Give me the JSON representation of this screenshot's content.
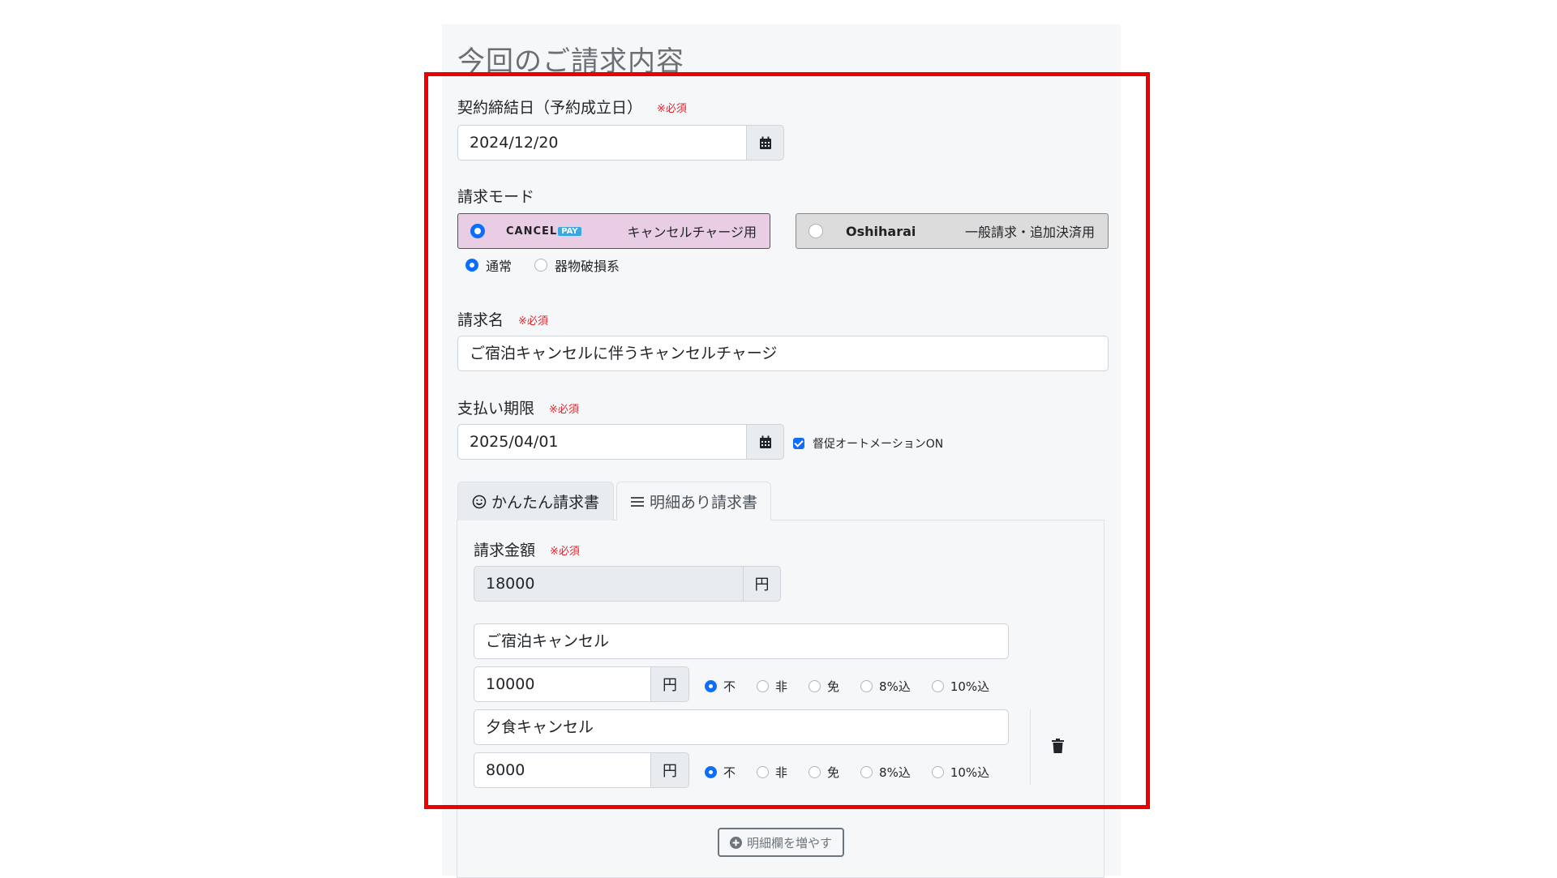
{
  "page": {
    "title": "今回のご請求内容"
  },
  "required_mark": "※必須",
  "contract_date": {
    "label": "契約締結日（予約成立日）",
    "value": "2024/12/20"
  },
  "billing_mode": {
    "label": "請求モード",
    "options": [
      {
        "logo_text": "CANCEL",
        "logo_badge": "PAY",
        "desc": "キャンセルチャージ用",
        "selected": true
      },
      {
        "logo_text": "Oshiharai",
        "desc": "一般請求・追加決済用",
        "selected": false
      }
    ],
    "sub_options": [
      {
        "label": "通常",
        "selected": true
      },
      {
        "label": "器物破損系",
        "selected": false
      }
    ]
  },
  "billing_name": {
    "label": "請求名",
    "value": "ご宿泊キャンセルに伴うキャンセルチャージ"
  },
  "due_date": {
    "label": "支払い期限",
    "value": "2025/04/01",
    "reminder_label": "督促オートメーションON"
  },
  "tabs": [
    {
      "label": "かんたん請求書",
      "icon": "smile-icon",
      "active": true
    },
    {
      "label": "明細あり請求書",
      "icon": "list-icon",
      "active": false
    }
  ],
  "amount": {
    "label": "請求金額",
    "value": "18000",
    "unit": "円"
  },
  "tax_options": [
    "不",
    "非",
    "免",
    "8%込",
    "10%込"
  ],
  "line_items": [
    {
      "name": "ご宿泊キャンセル",
      "amount": "10000",
      "unit": "円",
      "tax_selected": "不"
    },
    {
      "name": "夕食キャンセル",
      "amount": "8000",
      "unit": "円",
      "tax_selected": "不"
    }
  ],
  "add_row_button": {
    "label": "明細欄を増やす"
  },
  "colors": {
    "accent": "#0d6efd",
    "highlight": "#ee0000",
    "required": "#e0242b",
    "cancelpay_card": "#e8cde4",
    "oshiharai_card": "#dcdcdc"
  }
}
